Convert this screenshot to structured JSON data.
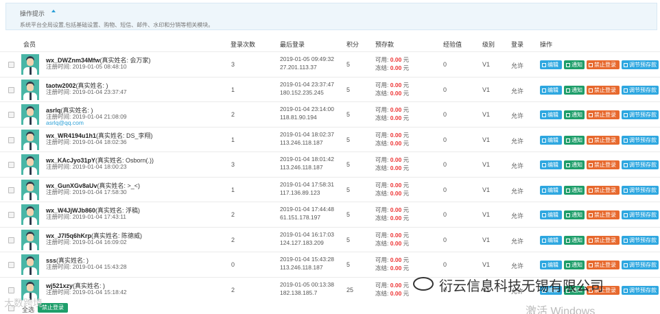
{
  "tips": {
    "title": "操作提示",
    "text": "系统平台全局设置,包括基础设置、购物、短信、邮件、水印和分销等相关模块。"
  },
  "table": {
    "headers": {
      "member": "会员",
      "login_count": "登录次数",
      "last_login": "最后登录",
      "points": "积分",
      "deposit": "预存款",
      "experience": "经验值",
      "level": "级别",
      "login": "登录",
      "actions": "操作"
    },
    "balance_labels": {
      "available": "可用:",
      "frozen": "冻结:",
      "currency": "元"
    },
    "buttons": {
      "edit": "编辑",
      "notify": "通知",
      "ban": "禁止登录",
      "adjust": "调节预存款"
    },
    "rows": [
      {
        "name": "wx_DWZnm34Mfw",
        "realname": "(真实姓名: 会万家)",
        "regtime": "注册时间: 2019-01-05 08:48:10",
        "email": "",
        "login_count": "3",
        "last_login_time": "2019-01-05 09:49:32",
        "last_login_ip": "27.201.113.37",
        "points": "5",
        "available": "0.00",
        "frozen": "0.00",
        "experience": "0",
        "level": "V1",
        "login": "允许"
      },
      {
        "name": "taotw2002",
        "realname": "(真实姓名: )",
        "regtime": "注册时间: 2019-01-04 23:37:47",
        "email": "",
        "login_count": "1",
        "last_login_time": "2019-01-04 23:37:47",
        "last_login_ip": "180.152.235.245",
        "points": "5",
        "available": "0.00",
        "frozen": "0.00",
        "experience": "0",
        "level": "V1",
        "login": "允许"
      },
      {
        "name": "asrlq",
        "realname": "(真实姓名: )",
        "regtime": "注册时间: 2019-01-04 21:08:09",
        "email": "asrlq@qq.com",
        "login_count": "2",
        "last_login_time": "2019-01-04 23:14:00",
        "last_login_ip": "118.81.90.194",
        "points": "5",
        "available": "0.00",
        "frozen": "0.00",
        "experience": "0",
        "level": "V1",
        "login": "允许"
      },
      {
        "name": "wx_WR4194u1h1",
        "realname": "(真实姓名: DS_李翔)",
        "regtime": "注册时间: 2019-01-04 18:02:36",
        "email": "",
        "login_count": "1",
        "last_login_time": "2019-01-04 18:02:37",
        "last_login_ip": "113.246.118.187",
        "points": "5",
        "available": "0.00",
        "frozen": "0.00",
        "experience": "0",
        "level": "V1",
        "login": "允许"
      },
      {
        "name": "wx_KAcJyo31pY",
        "realname": "(真实姓名: Osborn(.))",
        "regtime": "注册时间: 2019-01-04 18:00:23",
        "email": "",
        "login_count": "3",
        "last_login_time": "2019-01-04 18:01:42",
        "last_login_ip": "113.246.118.187",
        "points": "5",
        "available": "0.00",
        "frozen": "0.00",
        "experience": "0",
        "level": "V1",
        "login": "允许"
      },
      {
        "name": "wx_GunXGv8aUv",
        "realname": "(真实姓名: >_<)",
        "regtime": "注册时间: 2019-01-04 17:58:30",
        "email": "",
        "login_count": "1",
        "last_login_time": "2019-01-04 17:58:31",
        "last_login_ip": "117.136.89.123",
        "points": "5",
        "available": "0.00",
        "frozen": "0.00",
        "experience": "0",
        "level": "V1",
        "login": "允许"
      },
      {
        "name": "wx_W4JjWJb860",
        "realname": "(真实姓名: 浮稿)",
        "regtime": "注册时间: 2019-01-04 17:43:11",
        "email": "",
        "login_count": "2",
        "last_login_time": "2019-01-04 17:44:48",
        "last_login_ip": "61.151.178.197",
        "points": "5",
        "available": "0.00",
        "frozen": "0.00",
        "experience": "0",
        "level": "V1",
        "login": "允许"
      },
      {
        "name": "wx_J7l5q6hKrp",
        "realname": "(真实姓名: 陈德威)",
        "regtime": "注册时间: 2019-01-04 16:09:02",
        "email": "",
        "login_count": "2",
        "last_login_time": "2019-01-04 16:17:03",
        "last_login_ip": "124.127.183.209",
        "points": "5",
        "available": "0.00",
        "frozen": "0.00",
        "experience": "0",
        "level": "V1",
        "login": "允许"
      },
      {
        "name": "sss",
        "realname": "(真实姓名: )",
        "regtime": "注册时间: 2019-01-04 15:43:28",
        "email": "",
        "login_count": "0",
        "last_login_time": "2019-01-04 15:43:28",
        "last_login_ip": "113.246.118.187",
        "points": "5",
        "available": "0.00",
        "frozen": "0.00",
        "experience": "0",
        "level": "V1",
        "login": "允许"
      },
      {
        "name": "wj521xzy",
        "realname": "(真实姓名: )",
        "regtime": "注册时间: 2019-01-04 15:18:42",
        "email": "",
        "login_count": "2",
        "last_login_time": "2019-01-05 00:13:38",
        "last_login_ip": "182.138.185.7",
        "points": "25",
        "available": "0.00",
        "frozen": "0.00",
        "experience": "0",
        "level": "V1",
        "login": "允许"
      }
    ]
  },
  "footer": {
    "select_all": "全选",
    "ban_button": "禁止登录"
  },
  "watermarks": {
    "company": "衍云信息科技无锡有限公司",
    "windows": "激活 Windows",
    "corner": "大数跨境"
  }
}
